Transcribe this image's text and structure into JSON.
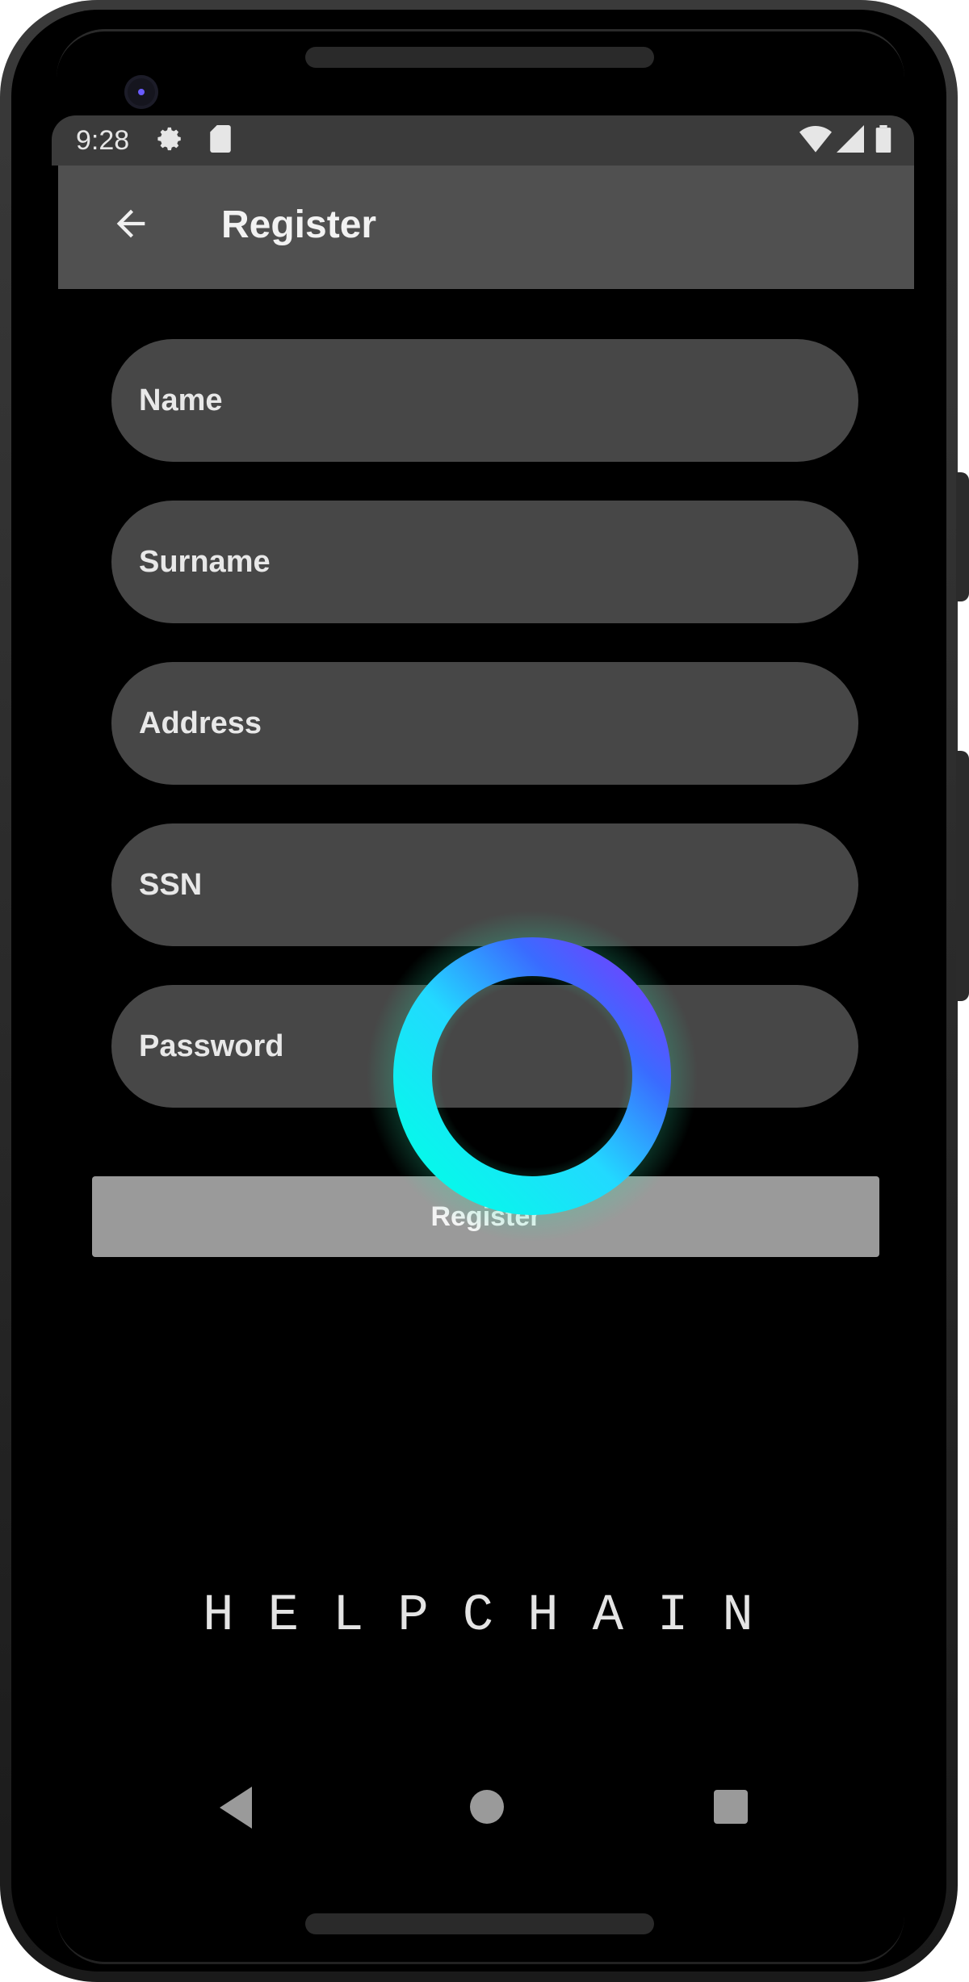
{
  "status_bar": {
    "time": "9:28",
    "settings_icon": "gear-icon",
    "sim_icon": "sim-card-icon",
    "wifi_icon": "wifi-icon",
    "signal_icon": "signal-icon",
    "battery_icon": "battery-icon"
  },
  "app_bar": {
    "back_icon": "arrow-left-icon",
    "title": "Register"
  },
  "form": {
    "name_placeholder": "Name",
    "surname_placeholder": "Surname",
    "address_placeholder": "Address",
    "ssn_placeholder": "SSN",
    "password_placeholder": "Password",
    "submit_label": "Register"
  },
  "loading": {
    "icon": "loading-ring-icon",
    "colors": [
      "#00ffe6",
      "#3a6bff",
      "#7a3cff",
      "#2be0a8"
    ]
  },
  "brand": {
    "name": "HELPCHAIN"
  },
  "nav_bar": {
    "back_icon": "nav-back-icon",
    "home_icon": "nav-home-icon",
    "recents_icon": "nav-recents-icon"
  },
  "colors": {
    "app_bar": "#505050",
    "field_background": "#474747",
    "button_background": "#9a9a9a"
  }
}
